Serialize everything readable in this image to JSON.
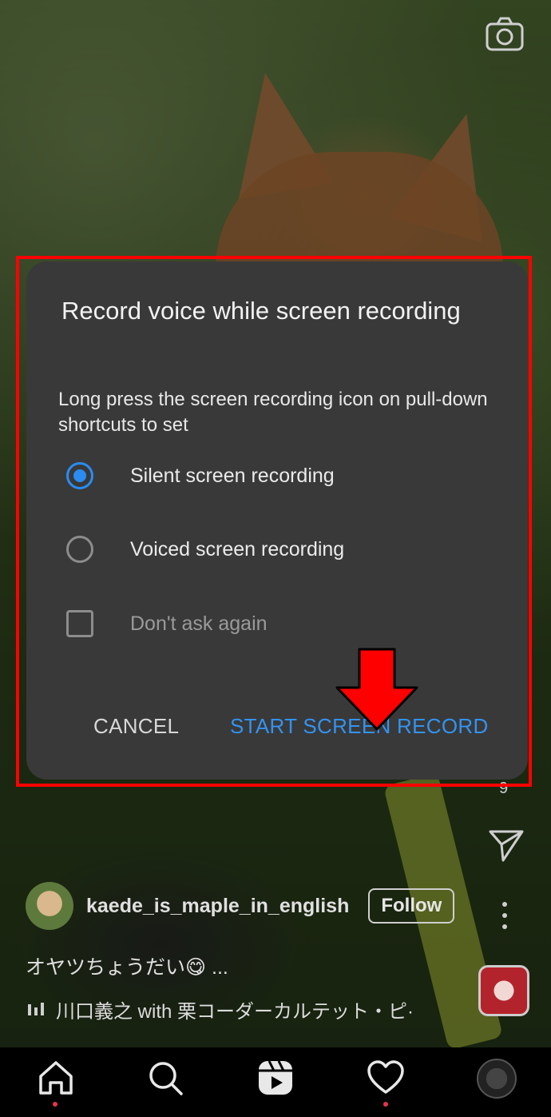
{
  "dialog": {
    "title": "Record voice while screen recording",
    "description": "Long press the screen recording icon on pull-down shortcuts to set",
    "options": [
      {
        "label": "Silent screen recording",
        "selected": true
      },
      {
        "label": "Voiced screen recording",
        "selected": false
      }
    ],
    "dont_ask_label": "Don't ask again",
    "dont_ask_checked": false,
    "cancel_label": "CANCEL",
    "start_label": "START SCREEN RECORD"
  },
  "post": {
    "username": "kaede_is_maple_in_english",
    "follow_label": "Follow",
    "caption": "オヤツちょうだい😋 ...",
    "music": "川口義之 with 栗コーダーカルテット・ピ·",
    "comment_count": "9"
  },
  "colors": {
    "accent_blue": "#2a8cf2",
    "highlight_red": "#ff0000",
    "dialog_bg": "#393939"
  },
  "icons": [
    "camera-icon",
    "send-icon",
    "more-icon",
    "music-icon",
    "home-icon",
    "search-icon",
    "reels-icon",
    "heart-icon"
  ]
}
